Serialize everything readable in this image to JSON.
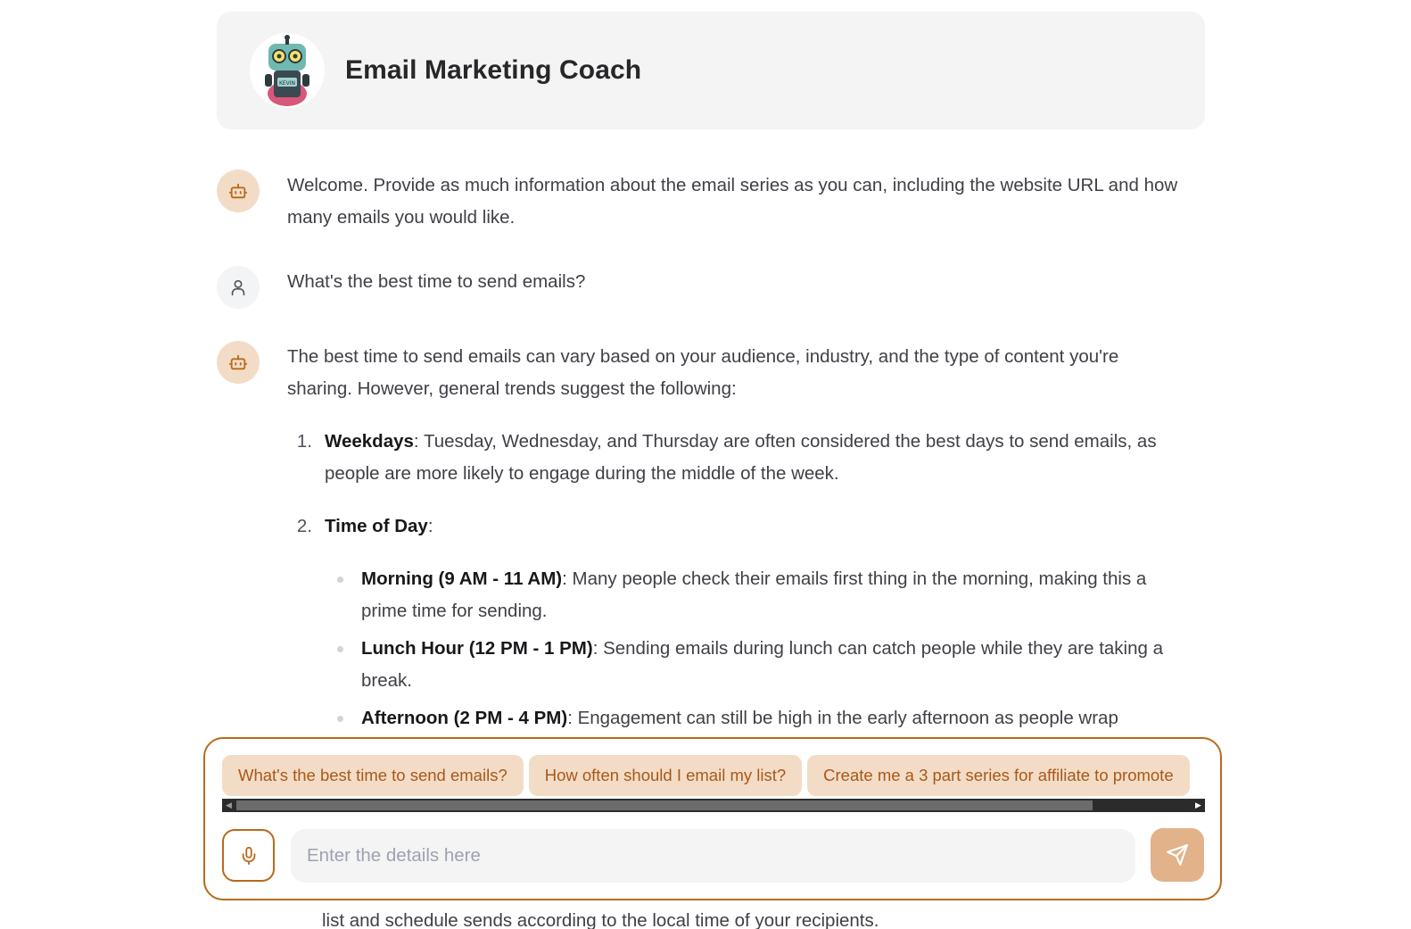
{
  "header": {
    "title": "Email Marketing Coach",
    "avatar_icon": "robot-avatar-icon",
    "avatar_badge_text": "KEVIN"
  },
  "messages": [
    {
      "role": "bot",
      "icon": "bot-icon",
      "text": "Welcome. Provide as much information about the email series as you can, including the website URL and how many emails you would like."
    },
    {
      "role": "user",
      "icon": "user-icon",
      "text": "What's the best time to send emails?"
    },
    {
      "role": "bot",
      "icon": "bot-icon",
      "intro": "The best time to send emails can vary based on your audience, industry, and the type of content you're sharing. However, general trends suggest the following:",
      "list": [
        {
          "num": "1.",
          "bold": "Weekdays",
          "text": ": Tuesday, Wednesday, and Thursday are often considered the best days to send emails, as people are more likely to engage during the middle of the week."
        },
        {
          "num": "2.",
          "bold": "Time of Day",
          "text": ":",
          "bullets": [
            {
              "bold": "Morning (9 AM - 11 AM)",
              "text": ": Many people check their emails first thing in the morning, making this a prime time for sending."
            },
            {
              "bold": "Lunch Hour (12 PM - 1 PM)",
              "text": ": Sending emails during lunch can catch people while they are taking a break."
            },
            {
              "bold": "Afternoon (2 PM - 4 PM)",
              "text": ": Engagement can still be high in the early afternoon as people wrap"
            }
          ]
        }
      ],
      "trailing_text": "list and schedule sends according to the local time of your recipients."
    }
  ],
  "composer": {
    "suggestions": [
      "What's the best time to send emails?",
      "How often should I email my list?",
      "Create me a 3 part series for affiliate to promote"
    ],
    "input_placeholder": "Enter the details here",
    "input_value": "",
    "mic_icon": "microphone-icon",
    "send_icon": "send-icon"
  },
  "colors": {
    "accent": "#b86a1b",
    "chip_bg": "#f3dcc6",
    "chip_text": "#a8581a",
    "send_bg": "#e2b28a",
    "header_bg": "#f4f4f4"
  }
}
